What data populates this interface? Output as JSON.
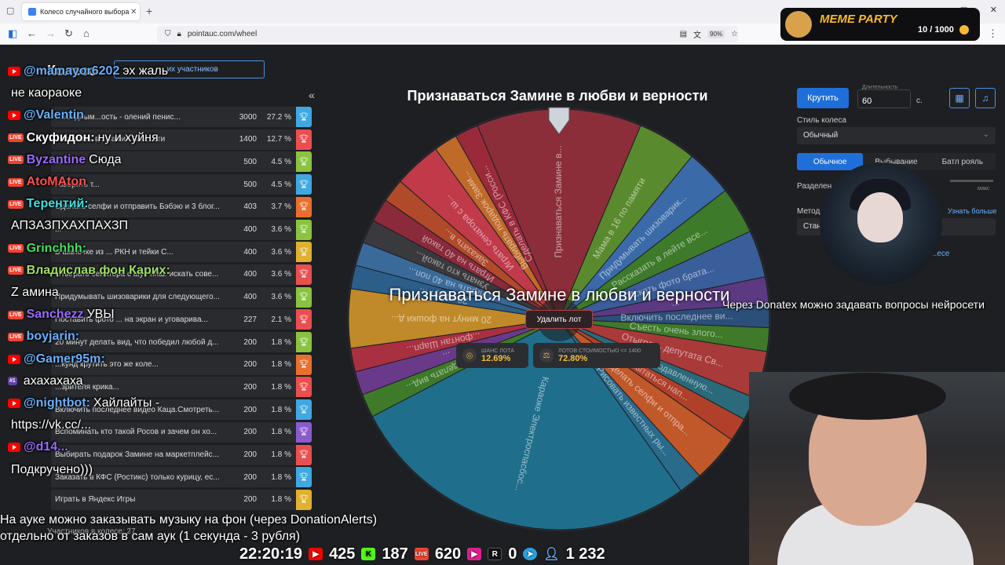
{
  "browser": {
    "tab_title": "Колесо случайного выбора – I",
    "url": "pointauc.com/wheel",
    "zoom": "90%"
  },
  "meme_party": {
    "title": "MEME PARTY",
    "counter": "10 / 1000"
  },
  "left_panel": {
    "header": "Колесо",
    "button": "...их участников",
    "participants": "Участников в колесе: 27",
    "rows": [
      {
        "name": "...обидным...ость - олений пенис...",
        "amount": "3000",
        "percent": "27.2 %",
        "color": "#3fa8e0"
      },
      {
        "name": "...заказать в ...тамин Зам...сти",
        "amount": "1400",
        "percent": "12.7 %",
        "color": "#e94f4f"
      },
      {
        "name": "...",
        "amount": "500",
        "percent": "4.5 %",
        "color": "#8ac340"
      },
      {
        "name": "Говорить т...",
        "amount": "500",
        "percent": "4.5 %",
        "color": "#3fa8e0"
      },
      {
        "name": "Сделать селфи и отправить Бэбэю и 3 блог...",
        "amount": "403",
        "percent": "3.7 %",
        "color": "#e8702e"
      },
      {
        "name": "...",
        "amount": "400",
        "percent": "3.6 %",
        "color": "#8ac340"
      },
      {
        "name": "В шапочке из ... РКН и тейки С...",
        "amount": "400",
        "percent": "3.6 %",
        "color": "#e0b030"
      },
      {
        "name": "Отыграть сенатора с шуе ппш: искать сове...",
        "amount": "400",
        "percent": "3.6 %",
        "color": "#e94f4f"
      },
      {
        "name": "Придумывать шизоварики для следующего...",
        "amount": "400",
        "percent": "3.6 %",
        "color": "#8ac340"
      },
      {
        "name": "Поставить фото ... на экран и уговарива...",
        "amount": "227",
        "percent": "2.1 %",
        "color": "#e94f4f"
      },
      {
        "name": "20 минут делать вид, что победил любой д...",
        "amount": "200",
        "percent": "1.8 %",
        "color": "#8ac340"
      },
      {
        "name": "...кунд крутить это же коле...",
        "amount": "200",
        "percent": "1.8 %",
        "color": "#e8702e"
      },
      {
        "name": "...зрителя крика...",
        "amount": "200",
        "percent": "1.8 %",
        "color": "#e94f4f"
      },
      {
        "name": "Включить последнее видео Каца.Смотреть...",
        "amount": "200",
        "percent": "1.8 %",
        "color": "#3fa8e0"
      },
      {
        "name": "Вспоминать кто такой Росов и зачем он хо...",
        "amount": "200",
        "percent": "1.8 %",
        "color": "#8a5ad0"
      },
      {
        "name": "Выбирать подарок Замине на маркетплейс...",
        "amount": "200",
        "percent": "1.8 %",
        "color": "#e94f4f"
      },
      {
        "name": "Заказать в КФС (Ростикс) только курицу, ес...",
        "amount": "200",
        "percent": "1.8 %",
        "color": "#3fa8e0"
      },
      {
        "name": "Играть в Яндекс Игры",
        "amount": "200",
        "percent": "1.8 %",
        "color": "#e0b030"
      }
    ]
  },
  "chat": [
    {
      "platform": "yt",
      "user": "@mamayor6202",
      "text": "эх жаль",
      "color": "#6ab0ff"
    },
    {
      "platform": "none",
      "user": "",
      "text": "не каораоке",
      "color": "#ffffff"
    },
    {
      "platform": "yt",
      "user": "@Valentin",
      "text": "",
      "color": "#6ab0ff"
    },
    {
      "platform": "live",
      "user": "Скуфидон:",
      "text": "ну и хуйня",
      "color": "#ffffff"
    },
    {
      "platform": "live",
      "user": "Byzantine",
      "text": "Сюда",
      "color": "#9b6bff"
    },
    {
      "platform": "live",
      "user": "AtoMAton",
      "text": "",
      "color": "#ff5050"
    },
    {
      "platform": "live",
      "user": "Терентий:",
      "text": "",
      "color": "#40e0e0"
    },
    {
      "platform": "none",
      "user": "",
      "text": "АПЗАЗПХАХПАХЗП",
      "color": "#ffffff"
    },
    {
      "platform": "live",
      "user": "Grinchhh:",
      "text": "",
      "color": "#40e060"
    },
    {
      "platform": "live",
      "user": "Владислав фон Карих:",
      "text": "",
      "color": "#a0e060"
    },
    {
      "platform": "none",
      "user": "",
      "text": "Z амина",
      "color": "#ffffff"
    },
    {
      "platform": "live",
      "user": "Sanchezz",
      "text": "УВЫ",
      "color": "#9b6bff"
    },
    {
      "platform": "live",
      "user": "boyjarin:",
      "text": "",
      "color": "#6ab0ff"
    },
    {
      "platform": "yt",
      "user": "@Gamer95m:",
      "text": "",
      "color": "#6ab0ff"
    },
    {
      "platform": "tw",
      "user": "",
      "text": "ахахахаха",
      "color": "#ffffff"
    },
    {
      "platform": "yt",
      "user": "@nightbot:",
      "text": "Хайлайты -",
      "color": "#6ab0ff"
    },
    {
      "platform": "none",
      "user": "",
      "text": "https://vk.cc/...",
      "color": "#6ab0ff"
    },
    {
      "platform": "yt",
      "user": "@d14...",
      "text": "",
      "color": "#9b6bff"
    },
    {
      "platform": "none",
      "user": "",
      "text": "Подкручено)))",
      "color": "#ffffff"
    }
  ],
  "wheel": {
    "title": "Признаваться Замине в любви и верности",
    "winner": "Признаваться Замине в любви и верности",
    "delete_button": "Удалить лот",
    "stat1_label": "ШАНС ЛОТА",
    "stat1_value": "12.69%",
    "stat2_label": "ЛОТОВ СТОИМОСТЬЮ <= 1400",
    "stat2_value": "72.80%",
    "segments": [
      {
        "label": "Признаваться Замине в...",
        "value": 1400,
        "color": "#8b2e3a"
      },
      {
        "label": "Мама в 16 по памяти",
        "value": 500,
        "color": "#5a8a2e"
      },
      {
        "label": "Придумывать шизоварик...",
        "value": 400,
        "color": "#3a6aa8"
      },
      {
        "label": "Рассказать в лейте все...",
        "value": 400,
        "color": "#3d7a2a"
      },
      {
        "label": "Искать фото брата...",
        "value": 400,
        "color": "#3a5e9a"
      },
      {
        "label": "...",
        "value": 227,
        "color": "#5b3a82"
      },
      {
        "label": "Включить последнее ви...",
        "value": 200,
        "color": "#2c4e7a"
      },
      {
        "label": "Съесть очень злого...",
        "value": 200,
        "color": "#3e7a2a"
      },
      {
        "label": "Отыграть депутата Св...",
        "value": 400,
        "color": "#a83a3a"
      },
      {
        "label": "Сделать подавленную...",
        "value": 200,
        "color": "#2a6a7a"
      },
      {
        "label": "Пытаться нап...",
        "value": 200,
        "color": "#b0402a"
      },
      {
        "label": "Сделать селфи и отпра...",
        "value": 403,
        "color": "#c0582a"
      },
      {
        "label": "Рисовать известных ры...",
        "value": 200,
        "color": "#2a6a8a"
      },
      {
        "label": "Караоке Электроспасбос...",
        "value": 3000,
        "color": "#1f6e8c"
      },
      {
        "label": "20 минут делать вид...",
        "value": 200,
        "color": "#3e7a2a"
      },
      {
        "label": "...",
        "value": 200,
        "color": "#6a3a8a"
      },
      {
        "label": "...фонтан Шарп...",
        "value": 200,
        "color": "#a83040"
      },
      {
        "label": "20 минут на фошки д...",
        "value": 500,
        "color": "#c08a2a"
      },
      {
        "label": "20 минут ...",
        "value": 200,
        "color": "#2c5e8a"
      },
      {
        "label": "Играть на 40 поп...",
        "value": 200,
        "color": "#3a6a9a"
      },
      {
        "label": "Узнать кто такой...",
        "value": 200,
        "color": "#3a3a3e"
      },
      {
        "label": "Играть на 40 такой",
        "value": 200,
        "color": "#8a2a3a"
      },
      {
        "label": "Заказать в...",
        "value": 200,
        "color": "#b04a2a"
      },
      {
        "label": "Играть сенатора с ш...",
        "value": 400,
        "color": "#c03a4a"
      },
      {
        "label": "Выбирать подарок Зами...",
        "value": 200,
        "color": "#c06a2a"
      },
      {
        "label": "Сделать в КФС (Росси...",
        "value": 200,
        "color": "#9a2a3a"
      }
    ]
  },
  "right_panel": {
    "spin_button": "Крутить",
    "duration_label": "Длительность",
    "duration_value": "60",
    "duration_unit": "с.",
    "style_label": "Стиль колеса",
    "style_value": "Обычный",
    "modes": [
      "Обычное",
      "Выбывание",
      "Батл рояль"
    ],
    "split_label": "Разделен...",
    "slider_max": "макс",
    "method_label": "Метод",
    "learn_more": "Узнать больше",
    "method_value": "Стан...",
    "more": "...есе"
  },
  "overlay": {
    "donatex_note": "Через Donatex можно задавать вопросы нейросети",
    "music_line1": "На ауке можно заказывать музыку на фон (через DonationAlerts)",
    "music_line2": "отдельно от заказов в сам аук (1 секунда - 3 рубля)"
  },
  "status": {
    "time": "22:20:19",
    "youtube": "425",
    "kick": "187",
    "vklive": "620",
    "rutube": "0",
    "viewers": "1 232"
  }
}
